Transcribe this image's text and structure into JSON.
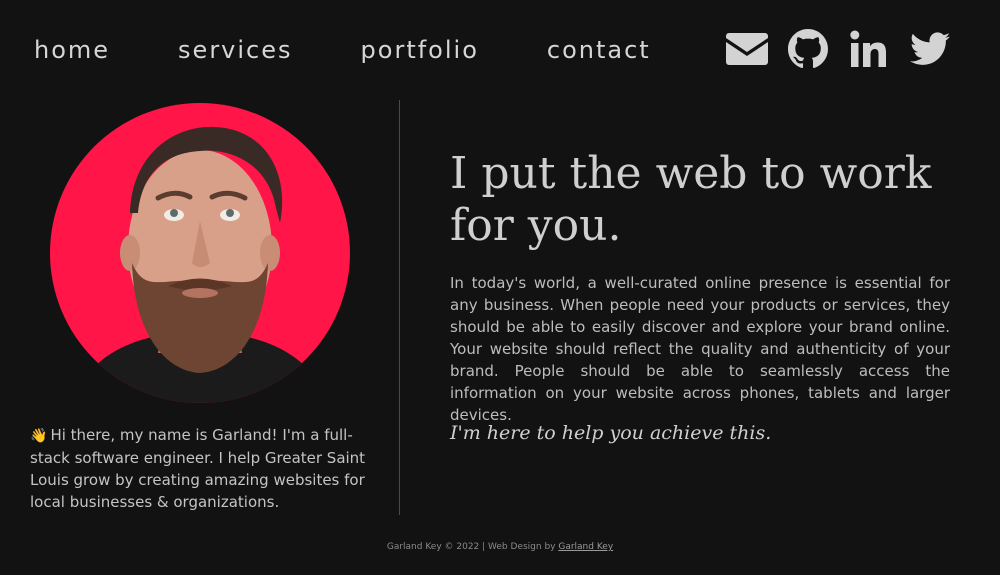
{
  "nav": {
    "items": [
      "home",
      "services",
      "portfolio",
      "contact"
    ]
  },
  "social": {
    "icons": [
      "mail-icon",
      "github-icon",
      "linkedin-icon",
      "twitter-icon"
    ],
    "linkedin_text": "in"
  },
  "profile": {
    "intro_text": "Hi there, my name is Garland! I'm a full-stack software engineer. I help Greater Saint Louis grow by creating amazing websites for local businesses & organizations.",
    "avatar_bg_color": "#ff1548"
  },
  "hero": {
    "headline": "I put the web to work for you.",
    "description": "In today's world, a well-curated online presence is essential for any business. When people need your products or services, they should be able to easily discover and explore your brand online. Your website should reflect the quality and authenticity of your brand. People should be able to seamlessly access the information on your website across phones, tablets and larger devices.",
    "tagline": "I'm here to help you achieve this."
  },
  "footer": {
    "prefix": "Garland Key © 2022 | Web Design by ",
    "link_text": "Garland Key"
  },
  "colors": {
    "background": "#121212",
    "accent": "#ff1548",
    "text": "#c9c9c9"
  }
}
